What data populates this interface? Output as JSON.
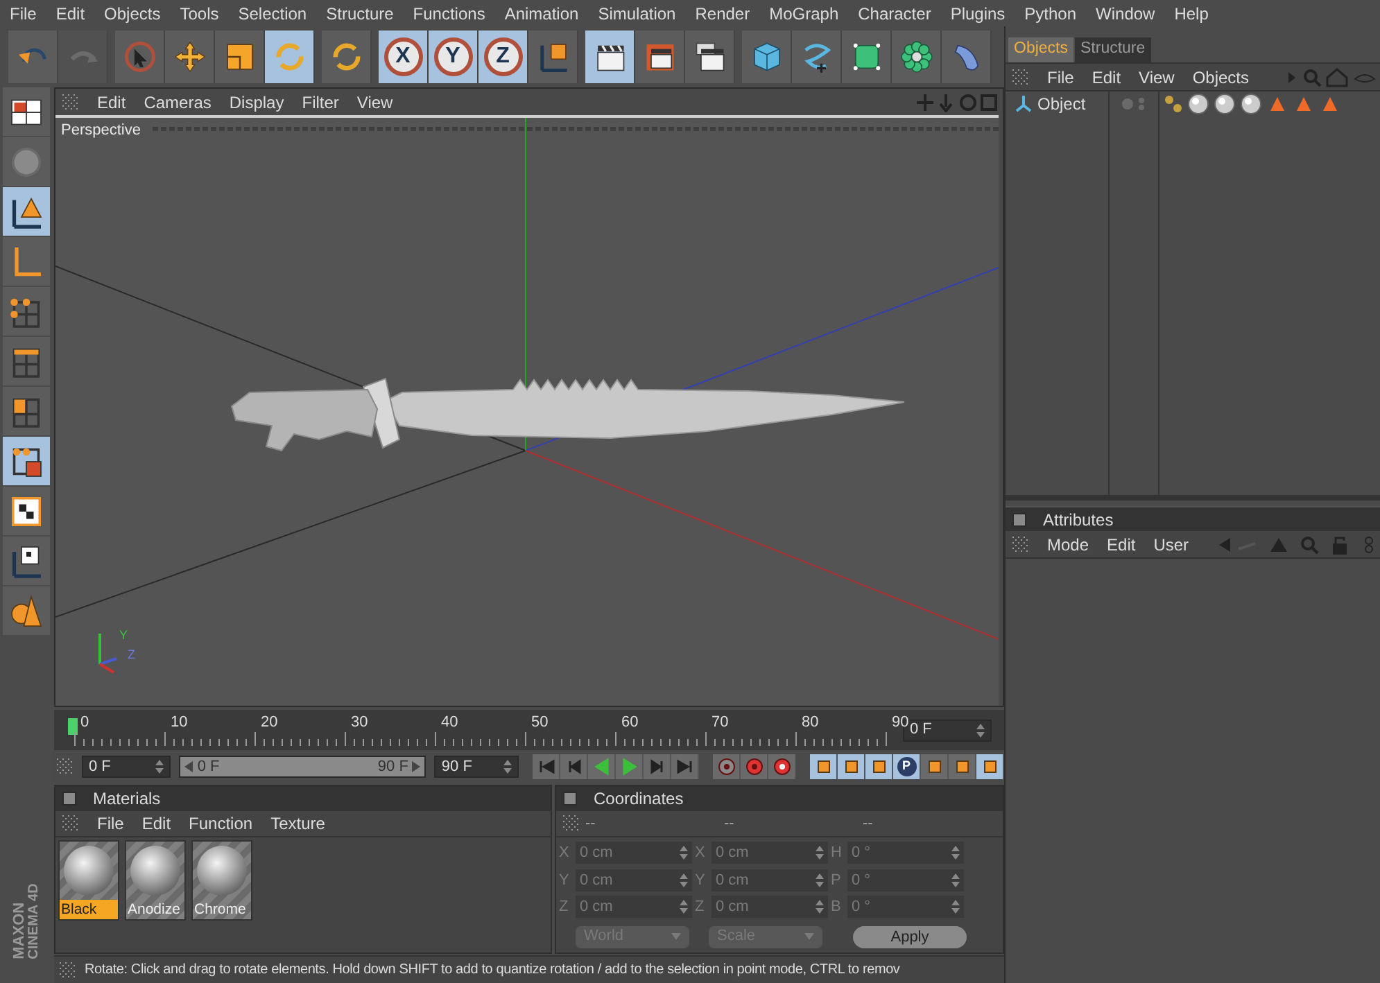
{
  "menu_bar": [
    "File",
    "Edit",
    "Objects",
    "Tools",
    "Selection",
    "Structure",
    "Functions",
    "Animation",
    "Simulation",
    "Render",
    "MoGraph",
    "Character",
    "Plugins",
    "Python",
    "Window",
    "Help"
  ],
  "toolbar": [
    [
      {
        "kind": "tool",
        "selected": false,
        "disabled": false
      },
      {
        "kind": "tool",
        "selected": false,
        "disabled": true
      }
    ],
    [
      {
        "kind": "tool",
        "selected": false,
        "disabled": false
      },
      {
        "kind": "tool",
        "selected": false,
        "disabled": false
      },
      {
        "kind": "tool",
        "selected": false,
        "disabled": false
      },
      {
        "kind": "tool",
        "selected": true,
        "disabled": false
      }
    ],
    [
      {
        "kind": "tool",
        "selected": false,
        "disabled": false
      }
    ],
    [
      {
        "kind": "axis",
        "label": "X",
        "selected": true,
        "disabled": false
      },
      {
        "kind": "axis",
        "label": "Y",
        "selected": true,
        "disabled": false
      },
      {
        "kind": "axis",
        "label": "Z",
        "selected": true,
        "disabled": false
      },
      {
        "kind": "tool",
        "selected": false,
        "disabled": false
      }
    ],
    [
      {
        "kind": "tool",
        "selected": true,
        "disabled": false
      },
      {
        "kind": "tool",
        "selected": false,
        "disabled": false
      },
      {
        "kind": "tool",
        "selected": false,
        "disabled": false
      }
    ],
    [
      {
        "kind": "tool",
        "selected": false,
        "disabled": false
      },
      {
        "kind": "tool",
        "selected": false,
        "disabled": false
      },
      {
        "kind": "tool",
        "selected": false,
        "disabled": false
      },
      {
        "kind": "tool",
        "selected": false,
        "disabled": false
      },
      {
        "kind": "tool",
        "selected": false,
        "disabled": false
      }
    ]
  ],
  "side_toolbar": [
    {
      "selected": false
    },
    {
      "selected": false
    },
    {
      "selected": true
    },
    {
      "selected": false
    },
    {
      "selected": false
    },
    {
      "selected": false
    },
    {
      "selected": false
    },
    {
      "selected": true
    },
    {
      "selected": false
    },
    {
      "selected": false
    },
    {
      "selected": false
    }
  ],
  "logo": {
    "line_1": "MAXON",
    "line_2": "CINEMA 4D"
  },
  "viewport": {
    "menu": [
      "Edit",
      "Cameras",
      "Display",
      "Filter",
      "View"
    ],
    "camera": "Perspective",
    "axis_gizmo": [
      "Y",
      "Z"
    ]
  },
  "timeline": {
    "labels": [
      "0",
      "10",
      "20",
      "30",
      "40",
      "50",
      "60",
      "70",
      "80",
      "90"
    ],
    "current_frame": "0 F",
    "start": "0 F",
    "range": {
      "start": "0 F",
      "end": "90 F",
      "level": 1
    },
    "end": "90 F",
    "key_buttons": [
      {
        "selected": true
      },
      {
        "selected": true
      },
      {
        "selected": true
      },
      {
        "selected": true,
        "label": "P"
      },
      {
        "selected": false
      },
      {
        "selected": false
      },
      {
        "selected": true
      }
    ]
  },
  "materials": {
    "title": "Materials",
    "menu": [
      "File",
      "Edit",
      "Function",
      "Texture"
    ],
    "items": [
      {
        "name": "Black",
        "selected": true
      },
      {
        "name": "Anodize",
        "selected": false
      },
      {
        "name": "Chrome",
        "selected": false
      }
    ]
  },
  "coordinates": {
    "title": "Coordinates",
    "disabled": true,
    "headers": [
      "--",
      "--",
      "--"
    ],
    "rows": [
      [
        {
          "axis": "X",
          "value": "0 cm"
        },
        {
          "axis": "X",
          "value": "0 cm"
        },
        {
          "axis": "H",
          "value": "0 °"
        }
      ],
      [
        {
          "axis": "Y",
          "value": "0 cm"
        },
        {
          "axis": "Y",
          "value": "0 cm"
        },
        {
          "axis": "P",
          "value": "0 °"
        }
      ],
      [
        {
          "axis": "Z",
          "value": "0 cm"
        },
        {
          "axis": "Z",
          "value": "0 cm"
        },
        {
          "axis": "B",
          "value": "0 °"
        }
      ]
    ],
    "space": "World",
    "mode": "Scale",
    "apply": "Apply"
  },
  "status_bar": "Rotate: Click and drag to rotate elements. Hold down SHIFT to add to quantize rotation / add to the selection in point mode, CTRL to remov",
  "object_manager": {
    "tabs": [
      {
        "label": "Objects",
        "selected": true
      },
      {
        "label": "Structure",
        "selected": false
      }
    ],
    "menu": [
      "File",
      "Edit",
      "View",
      "Objects"
    ],
    "objects": [
      {
        "name": "Object",
        "selected": false
      }
    ]
  },
  "attributes": {
    "title": "Attributes",
    "menu": [
      "Mode",
      "Edit",
      "User"
    ]
  }
}
